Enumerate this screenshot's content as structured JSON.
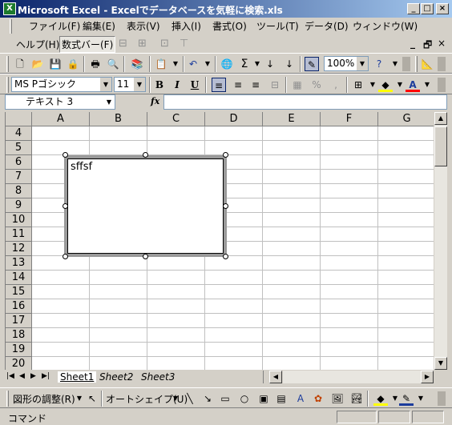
{
  "window": {
    "app_icon": "X",
    "title": "Microsoft Excel - Excelでデータベースを気軽に検索.xls",
    "min": "_",
    "max": "□",
    "close": "×"
  },
  "menu": {
    "items": [
      "ファイル(F)",
      "編集(E)",
      "表示(V)",
      "挿入(I)",
      "書式(O)",
      "ツール(T)",
      "データ(D)",
      "ウィンドウ(W)"
    ],
    "row2": [
      "ヘルプ(H)",
      "数式バー(F)"
    ],
    "doc_controls": [
      "_",
      "🗗",
      "×"
    ]
  },
  "toolbar": {
    "zoom": "100%"
  },
  "format": {
    "font": "MS Pゴシック",
    "size": "11",
    "bold": "B",
    "italic": "I",
    "underline": "U",
    "percent": "%",
    "comma": ","
  },
  "formula_bar": {
    "name_box": "テキスト 3",
    "fx": "fx",
    "value": ""
  },
  "grid": {
    "columns": [
      "A",
      "B",
      "C",
      "D",
      "E",
      "F",
      "G"
    ],
    "rows": [
      "4",
      "5",
      "6",
      "7",
      "8",
      "9",
      "10",
      "11",
      "12",
      "13",
      "14",
      "15",
      "16",
      "17",
      "18",
      "19",
      "20"
    ]
  },
  "textbox": {
    "content": "sffsf"
  },
  "sheets": {
    "tabs": [
      "Sheet1",
      "Sheet2",
      "Sheet3"
    ],
    "active": "Sheet1"
  },
  "drawing": {
    "adjust": "図形の調整(R)",
    "autoshape": "オートシェイプ(U)"
  },
  "status": {
    "text": "コマンド"
  }
}
